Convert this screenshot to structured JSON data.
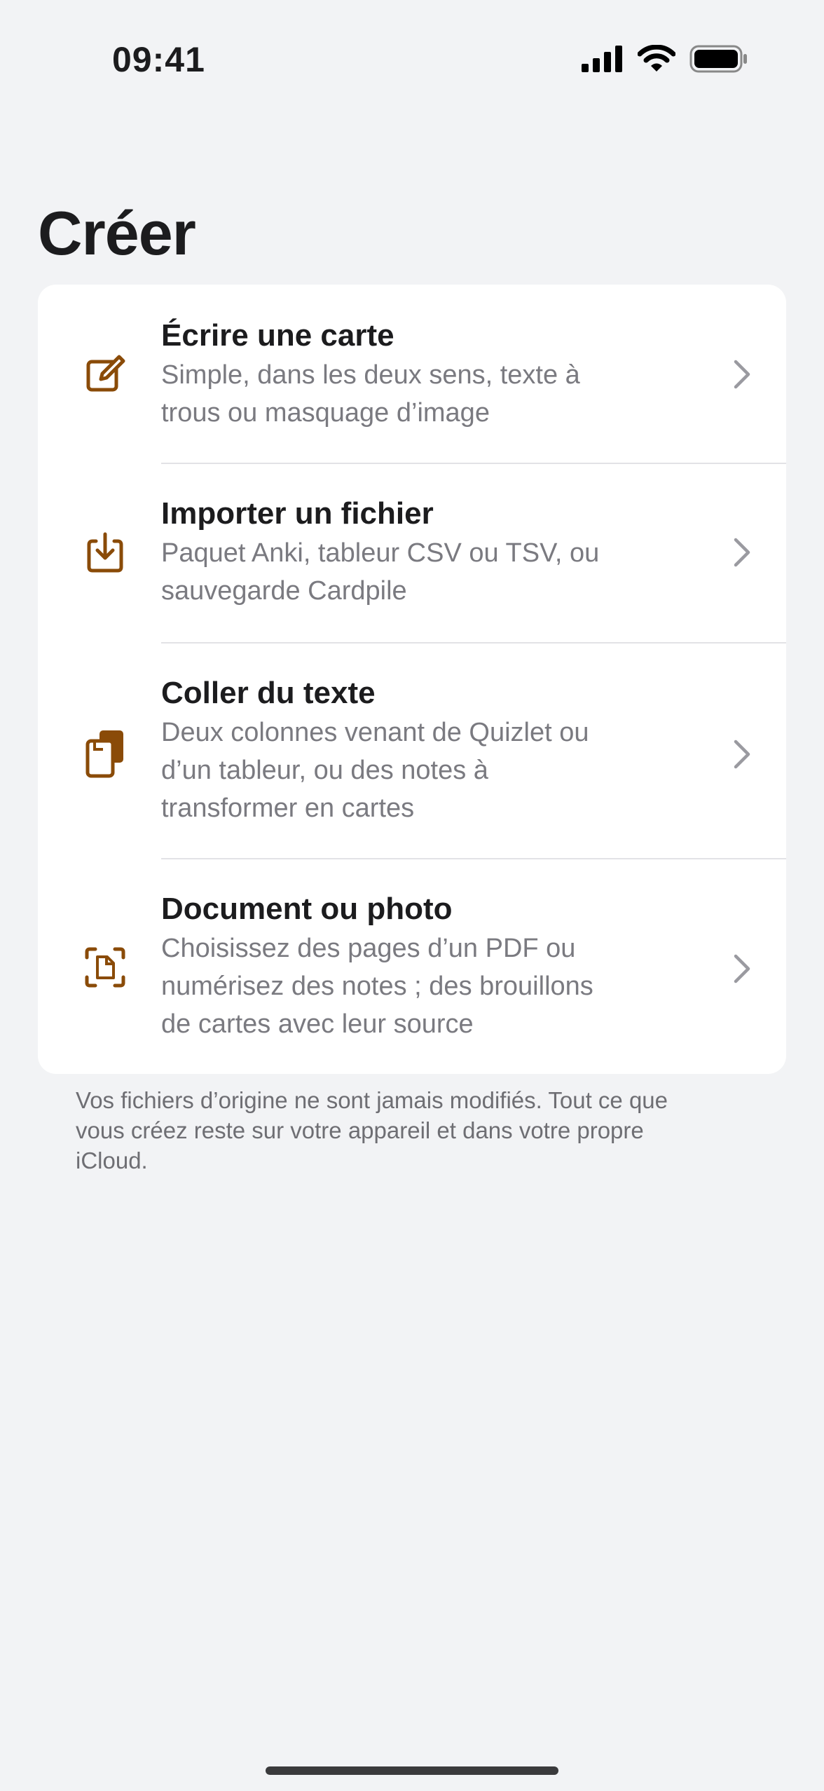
{
  "status_bar": {
    "time": "09:41",
    "signal_icon": "cellular-signal-icon",
    "wifi_icon": "wifi-icon",
    "battery_icon": "battery-icon"
  },
  "page": {
    "title": "Créer"
  },
  "colors": {
    "accent": "#8a4b08",
    "background": "#f2f3f5",
    "card": "#ffffff",
    "secondary_text": "#7a7a80",
    "chevron": "#9a9aa0"
  },
  "options": [
    {
      "icon": "compose-pencil-icon",
      "title": "Écrire une carte",
      "subtitle_lines": [
        "Simple, dans les deux sens, texte à",
        "trous ou masquage d’image"
      ]
    },
    {
      "icon": "import-tray-arrow-icon",
      "title": "Importer un fichier",
      "subtitle_lines": [
        "Paquet Anki, tableur CSV ou TSV, ou",
        "sauvegarde Cardpile"
      ]
    },
    {
      "icon": "paste-clipboard-icon",
      "title": "Coller du texte",
      "subtitle_lines": [
        "Deux colonnes venant de Quizlet ou",
        "d’un tableur, ou des notes à",
        "transformer en cartes"
      ]
    },
    {
      "icon": "document-scan-icon",
      "title": "Document ou photo",
      "subtitle_lines": [
        "Choisissez des pages d’un PDF ou",
        "numérisez des notes ; des brouillons",
        "de cartes avec leur source"
      ]
    }
  ],
  "footer": {
    "lines": [
      "Vos fichiers d’origine ne sont jamais modifiés. Tout ce que",
      "vous créez reste sur votre appareil et dans votre propre",
      "iCloud."
    ]
  }
}
